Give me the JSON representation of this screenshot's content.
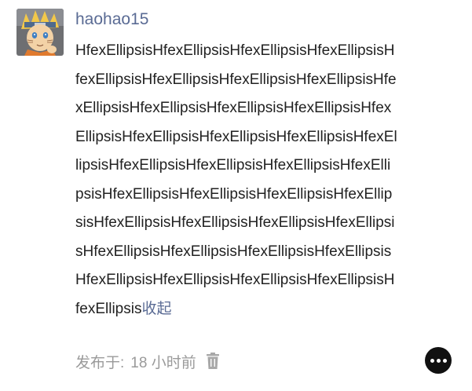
{
  "post": {
    "username": "haohao15",
    "content_lines": [
      "HfexEllipsisHfexEllipsisHfexEllipsisHfexEllipsisH",
      "fexEllipsisHfexEllipsisHfexEllipsisHfexEllipsisHfe",
      "xEllipsisHfexEllipsisHfexEllipsisHfexEllipsisHfex",
      "EllipsisHfexEllipsisHfexEllipsisHfexEllipsisHfexEl",
      "lipsisHfexEllipsisHfexEllipsisHfexEllipsisHfexElli",
      "psisHfexEllipsisHfexEllipsisHfexEllipsisHfexEllip",
      "sisHfexEllipsisHfexEllipsisHfexEllipsisHfexEllipsi",
      "sHfexEllipsisHfexEllipsisHfexEllipsisHfexEllipsis",
      "HfexEllipsisHfexEllipsisHfexEllipsisHfexEllipsisH",
      "fexEllipsis"
    ],
    "collapse_label": "收起",
    "meta_prefix": "发布于:",
    "meta_time": "18 小时前"
  },
  "icons": {
    "delete": "trash-icon",
    "more": "more-dots-icon"
  },
  "colors": {
    "username": "#5a6b94",
    "link": "#5a6b94",
    "meta": "#9a9a9a",
    "text": "#222222",
    "more_button": "#111111"
  }
}
